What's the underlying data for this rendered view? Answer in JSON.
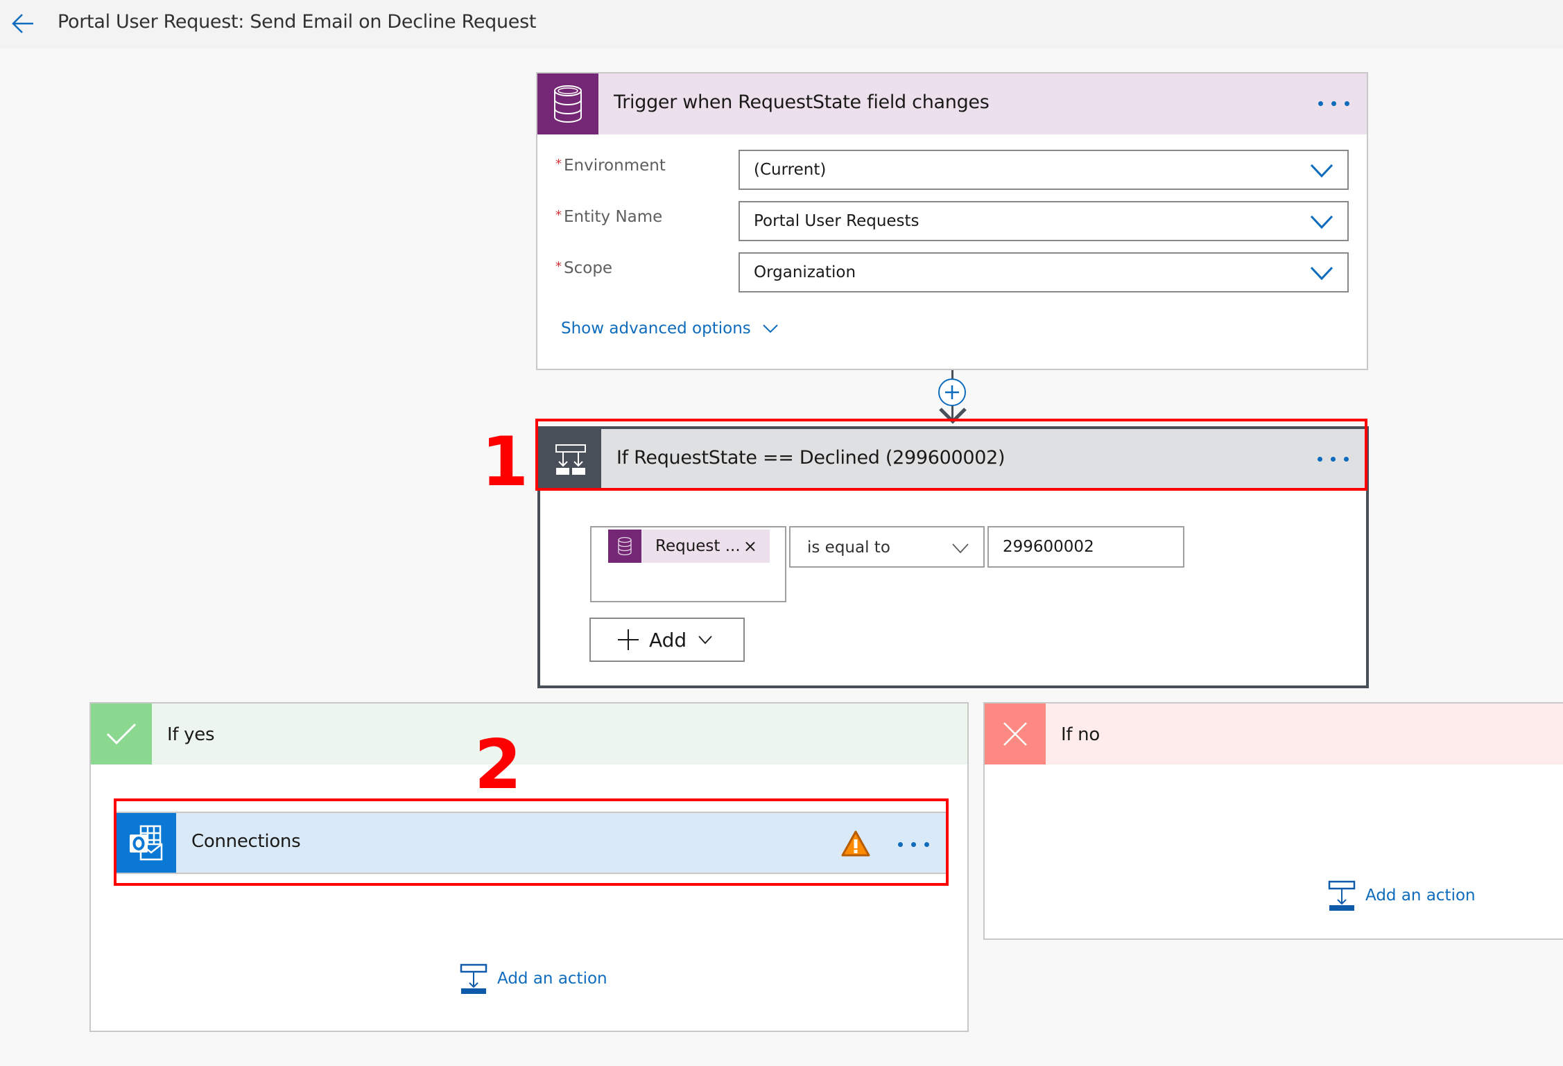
{
  "header": {
    "back_icon": "arrow-left-icon",
    "title": "Portal User Request: Send Email on Decline Request"
  },
  "trigger": {
    "icon": "database-icon",
    "title": "Trigger when RequestState field changes",
    "more_icon": "ellipsis-icon",
    "fields": [
      {
        "label": "Environment",
        "required": "*",
        "value": "(Current)"
      },
      {
        "label": "Entity Name",
        "required": "*",
        "value": "Portal User Requests"
      },
      {
        "label": "Scope",
        "required": "*",
        "value": "Organization"
      }
    ],
    "advanced_link": "Show advanced options"
  },
  "connector": {
    "insert_icon": "plus-circle-icon",
    "arrow_icon": "arrow-down-icon"
  },
  "condition": {
    "icon": "condition-icon",
    "title": "If RequestState == Declined (299600002)",
    "more_icon": "ellipsis-icon",
    "row": {
      "token_label": "Request ...",
      "token_remove": "×",
      "operator": "is equal to",
      "value": "299600002"
    },
    "add_label": "Add"
  },
  "branches": {
    "yes": {
      "icon": "checkmark-icon",
      "title": "If yes",
      "action": {
        "icon": "outlook-icon",
        "title": "Connections",
        "status_icon": "warning-icon",
        "more_icon": "ellipsis-icon"
      },
      "add_action": "Add an action"
    },
    "no": {
      "icon": "close-icon",
      "title": "If no",
      "add_action": "Add an action"
    }
  },
  "annotations": {
    "first": "1",
    "second": "2"
  },
  "colors": {
    "accent": "#0f6cbd",
    "dataverse": "#742774",
    "condition": "#484f58",
    "yes": "#8bd990",
    "no": "#fd8a82",
    "outlook": "#0a78d4",
    "warning": "#ff8c00",
    "annotation": "#ff0000"
  }
}
